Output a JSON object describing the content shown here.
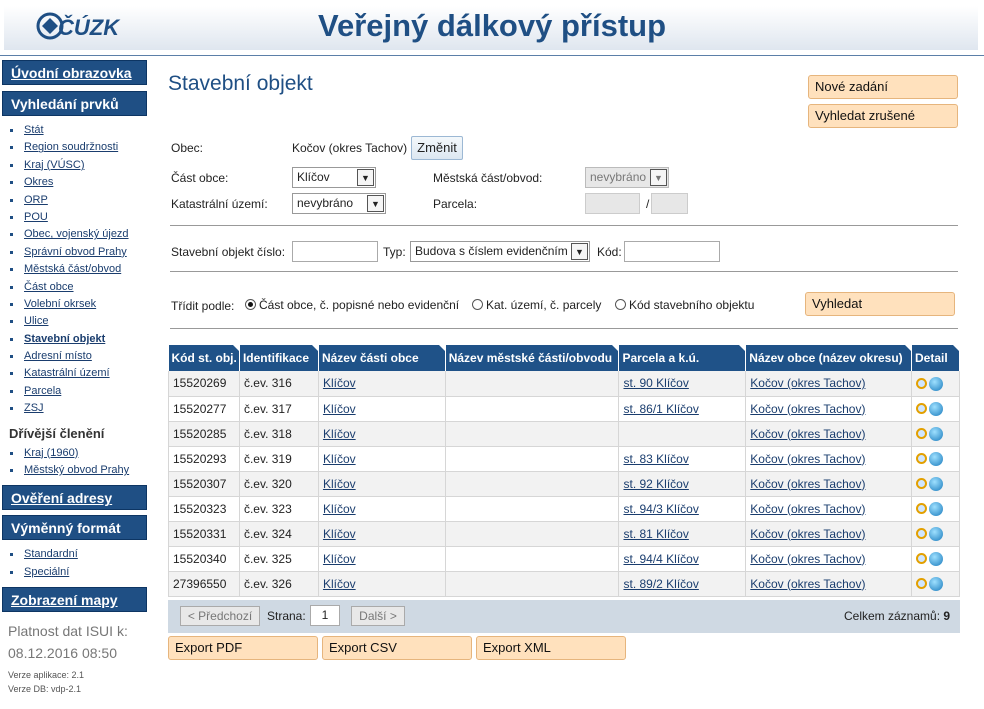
{
  "header": {
    "logo_text": "ČÚZK",
    "title": "Veřejný dálkový přístup"
  },
  "sidebar": {
    "home": "Úvodní obrazovka",
    "search": "Vyhledání prvků",
    "search_items": [
      "Stát",
      "Region soudržnosti",
      "Kraj (VÚSC)",
      "Okres",
      "ORP",
      "POU",
      "Obec, vojenský újezd",
      "Správní obvod Prahy",
      "Městská část/obvod",
      "Část obce",
      "Volební okrsek",
      "Ulice",
      "Stavební objekt",
      "Adresní místo",
      "Katastrální území",
      "Parcela",
      "ZSJ"
    ],
    "former": "Dřívější členění",
    "former_items": [
      "Kraj (1960)",
      "Městský obvod Prahy"
    ],
    "verify": "Ověření adresy",
    "exchange": "Výměnný formát",
    "exchange_items": [
      "Standardní",
      "Speciální"
    ],
    "map": "Zobrazení mapy",
    "validity_label": "Platnost dat ISUI k:",
    "validity_date": "08.12.2016 08:50",
    "app_version": "Verze aplikace: 2.1",
    "db_version": "Verze DB: vdp-2.1"
  },
  "main": {
    "title": "Stavební objekt",
    "new_button": "Nové zadání",
    "cancelled_button": "Vyhledat zrušené",
    "obec_label": "Obec:",
    "obec_value": "Kočov (okres Tachov)",
    "change_button": "Změnit",
    "cast_label": "Část obce:",
    "cast_value": "Klíčov",
    "mestska_label": "Městská část/obvod:",
    "mestska_value": "nevybráno",
    "ku_label": "Katastrální území:",
    "ku_value": "nevybráno",
    "parcela_label": "Parcela:",
    "parcela_sep": "/",
    "so_label": "Stavební objekt číslo:",
    "typ_label": "Typ:",
    "typ_value": "Budova s číslem evidenčním",
    "kod_label": "Kód:",
    "sort_label": "Třídit podle:",
    "sort_options": [
      "Část obce, č. popisné nebo evidenční",
      "Kat. území, č. parcely",
      "Kód stavebního objektu"
    ],
    "search_button": "Vyhledat"
  },
  "table": {
    "headers": [
      "Kód st. obj.",
      "Identifikace",
      "Název části obce",
      "Název městské části/obvodu",
      "Parcela a k.ú.",
      "Název obce (název okresu)",
      "Detail"
    ],
    "rows": [
      [
        "15520269",
        "č.ev. 316",
        "Klíčov",
        "",
        "st. 90 Klíčov",
        "Kočov (okres Tachov)"
      ],
      [
        "15520277",
        "č.ev. 317",
        "Klíčov",
        "",
        "st. 86/1 Klíčov",
        "Kočov (okres Tachov)"
      ],
      [
        "15520285",
        "č.ev. 318",
        "Klíčov",
        "",
        "",
        "Kočov (okres Tachov)"
      ],
      [
        "15520293",
        "č.ev. 319",
        "Klíčov",
        "",
        "st. 83 Klíčov",
        "Kočov (okres Tachov)"
      ],
      [
        "15520307",
        "č.ev. 320",
        "Klíčov",
        "",
        "st. 92 Klíčov",
        "Kočov (okres Tachov)"
      ],
      [
        "15520323",
        "č.ev. 323",
        "Klíčov",
        "",
        "st. 94/3 Klíčov",
        "Kočov (okres Tachov)"
      ],
      [
        "15520331",
        "č.ev. 324",
        "Klíčov",
        "",
        "st. 81 Klíčov",
        "Kočov (okres Tachov)"
      ],
      [
        "15520340",
        "č.ev. 325",
        "Klíčov",
        "",
        "st. 94/4 Klíčov",
        "Kočov (okres Tachov)"
      ],
      [
        "27396550",
        "č.ev. 326",
        "Klíčov",
        "",
        "st. 89/2 Klíčov",
        "Kočov (okres Tachov)"
      ]
    ]
  },
  "pager": {
    "prev": "< Předchozí",
    "page_label": "Strana:",
    "page": "1",
    "next": "Další >",
    "total_label": "Celkem záznamů:",
    "total": "9"
  },
  "export": {
    "pdf": "Export PDF",
    "csv": "Export CSV",
    "xml": "Export XML"
  }
}
